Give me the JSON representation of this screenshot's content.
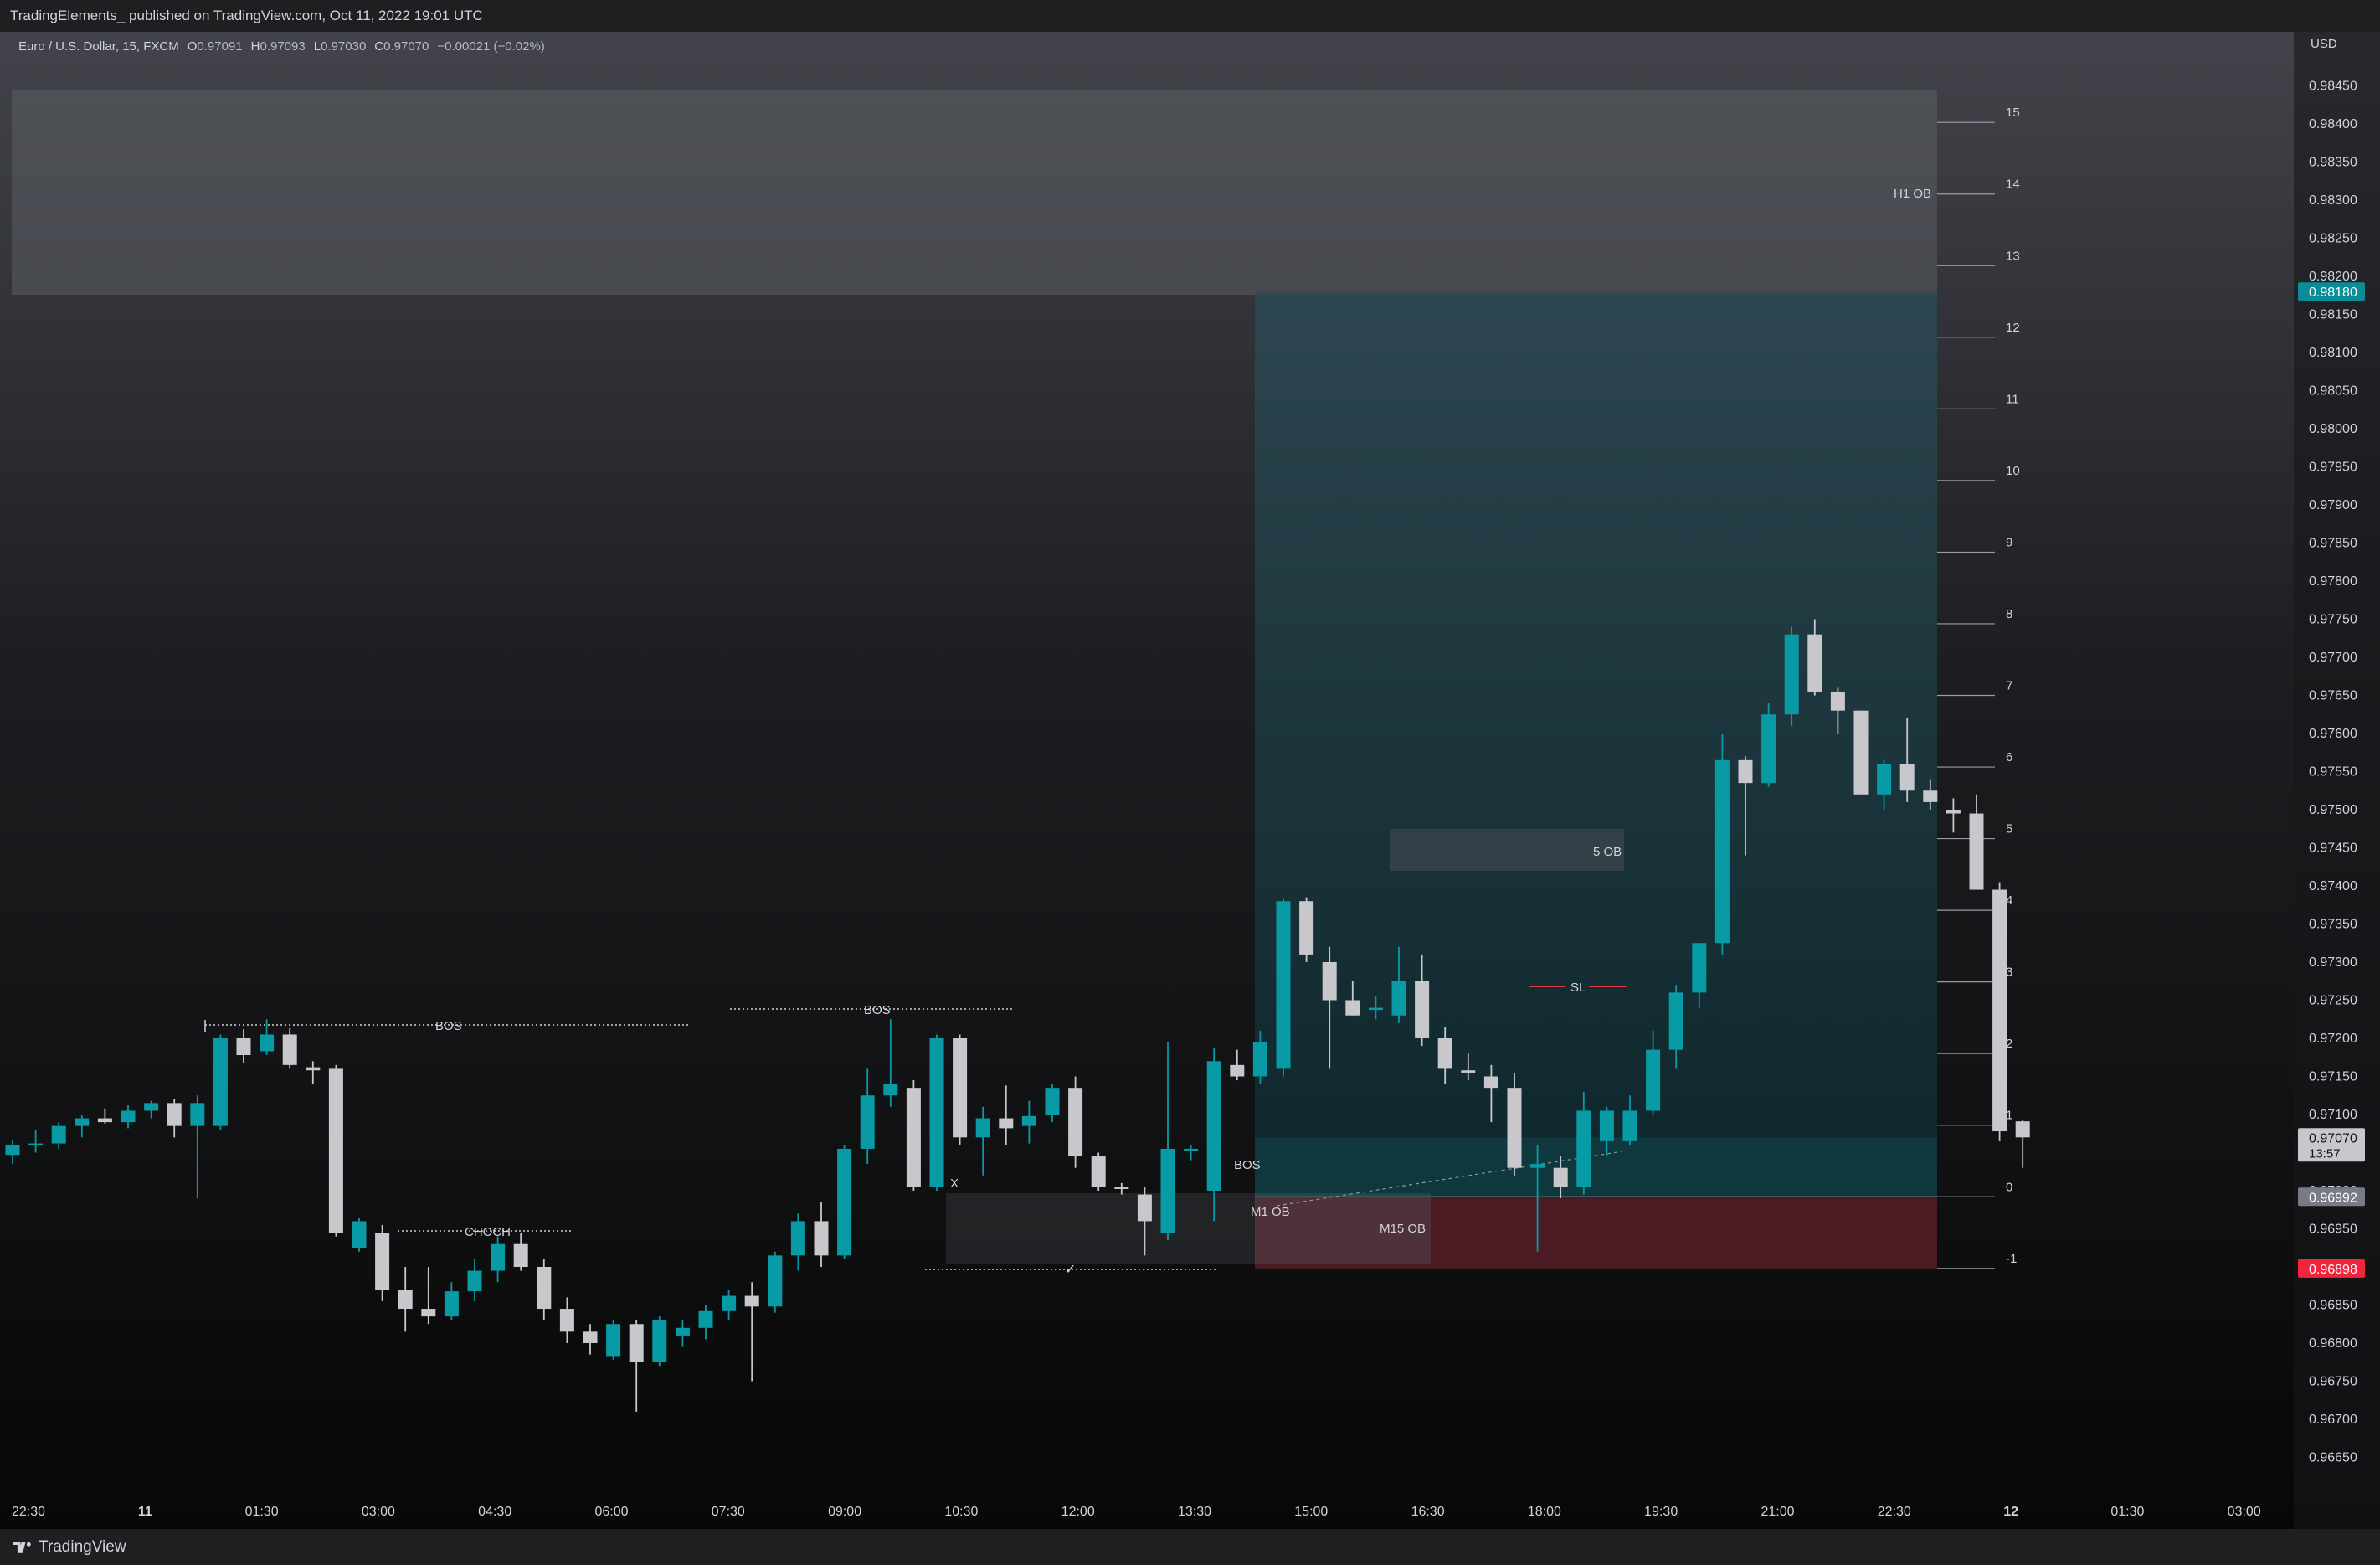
{
  "header": {
    "published_line": "TradingElements_ published on TradingView.com, Oct 11, 2022 19:01 UTC"
  },
  "symbol": {
    "title": "Euro / U.S. Dollar, 15, FXCM",
    "o_label": "O",
    "o_value": "0.97091",
    "h_label": "H",
    "h_value": "0.97093",
    "l_label": "L",
    "l_value": "0.97030",
    "c_label": "C",
    "c_value": "0.97070",
    "change": "−0.00021 (−0.02%)"
  },
  "footer": {
    "brand": "TradingView",
    "brand_icon": "tradingview-logo-icon"
  },
  "colors": {
    "background_top": "#43444b",
    "background_bottom": "#070707",
    "bull": "#089ba6",
    "bear": "#c8c8cc",
    "target_zone": "#154049",
    "stop_zone": "#4a1b22",
    "price_tag_current": "#c8c8cc",
    "price_tag_target": "#0a8d99",
    "price_tag_stop": "#f0253b",
    "price_tag_entry": "#787b86",
    "sl_line": "#e23a43"
  },
  "chart_data": {
    "type": "candlestick",
    "title": "Euro / U.S. Dollar, 15, FXCM",
    "currency_label": "USD",
    "x_start_label": "22:30",
    "x_tick_labels": [
      "22:30",
      "11",
      "01:30",
      "03:00",
      "04:30",
      "06:00",
      "07:30",
      "09:00",
      "10:30",
      "12:00",
      "13:30",
      "15:00",
      "16:30",
      "18:00",
      "19:30",
      "21:00",
      "22:30",
      "12",
      "01:30",
      "03:00"
    ],
    "y_range": [
      0.9663,
      0.9849
    ],
    "y_tick_labels": [
      "0.98450",
      "0.98400",
      "0.98350",
      "0.98300",
      "0.98250",
      "0.98200",
      "0.98150",
      "0.98100",
      "0.98050",
      "0.98000",
      "0.97950",
      "0.97900",
      "0.97850",
      "0.97800",
      "0.97750",
      "0.97700",
      "0.97650",
      "0.97600",
      "0.97550",
      "0.97500",
      "0.97450",
      "0.97400",
      "0.97350",
      "0.97300",
      "0.97250",
      "0.97200",
      "0.97150",
      "0.97100",
      "0.97050",
      "0.97000",
      "0.96950",
      "0.96900",
      "0.96850",
      "0.96800",
      "0.96750",
      "0.96700",
      "0.96650"
    ],
    "price_tags": {
      "current": "0.97070",
      "countdown": "13:57",
      "target": "0.98180",
      "entry": "0.96992",
      "stop": "0.96898"
    },
    "r_levels": {
      "labels": [
        "15",
        "14",
        "13",
        "12",
        "11",
        "10",
        "9",
        "8",
        "7",
        "6",
        "5",
        "4",
        "3",
        "2",
        "1",
        "0",
        "-1"
      ],
      "zero_price": 0.96992,
      "step": 0.00094
    },
    "candles": [
      {
        "o": 0.97047,
        "h": 0.97067,
        "l": 0.97035,
        "c": 0.9706
      },
      {
        "o": 0.9706,
        "h": 0.9708,
        "l": 0.9705,
        "c": 0.97062
      },
      {
        "o": 0.97062,
        "h": 0.9709,
        "l": 0.97055,
        "c": 0.97085
      },
      {
        "o": 0.97085,
        "h": 0.971,
        "l": 0.9707,
        "c": 0.97095
      },
      {
        "o": 0.97095,
        "h": 0.97108,
        "l": 0.97088,
        "c": 0.9709
      },
      {
        "o": 0.9709,
        "h": 0.97112,
        "l": 0.97082,
        "c": 0.97105
      },
      {
        "o": 0.97105,
        "h": 0.97118,
        "l": 0.97095,
        "c": 0.97115
      },
      {
        "o": 0.97115,
        "h": 0.9712,
        "l": 0.9707,
        "c": 0.97085
      },
      {
        "o": 0.97085,
        "h": 0.97125,
        "l": 0.9699,
        "c": 0.97115
      },
      {
        "o": 0.97085,
        "h": 0.97205,
        "l": 0.9708,
        "c": 0.972
      },
      {
        "o": 0.972,
        "h": 0.97212,
        "l": 0.97168,
        "c": 0.97178
      },
      {
        "o": 0.97183,
        "h": 0.97225,
        "l": 0.97178,
        "c": 0.97205
      },
      {
        "o": 0.97205,
        "h": 0.97213,
        "l": 0.9716,
        "c": 0.97165
      },
      {
        "o": 0.97162,
        "h": 0.9717,
        "l": 0.9714,
        "c": 0.97158
      },
      {
        "o": 0.9716,
        "h": 0.97165,
        "l": 0.9694,
        "c": 0.96945
      },
      {
        "o": 0.96925,
        "h": 0.96965,
        "l": 0.9692,
        "c": 0.9696
      },
      {
        "o": 0.96945,
        "h": 0.96955,
        "l": 0.96855,
        "c": 0.9687
      },
      {
        "o": 0.9687,
        "h": 0.969,
        "l": 0.96815,
        "c": 0.96845
      },
      {
        "o": 0.96845,
        "h": 0.969,
        "l": 0.96825,
        "c": 0.96835
      },
      {
        "o": 0.96835,
        "h": 0.9688,
        "l": 0.9683,
        "c": 0.96868
      },
      {
        "o": 0.96868,
        "h": 0.9691,
        "l": 0.96855,
        "c": 0.96895
      },
      {
        "o": 0.96895,
        "h": 0.9694,
        "l": 0.9688,
        "c": 0.9693
      },
      {
        "o": 0.9693,
        "h": 0.96945,
        "l": 0.96895,
        "c": 0.969
      },
      {
        "o": 0.969,
        "h": 0.9691,
        "l": 0.9683,
        "c": 0.96845
      },
      {
        "o": 0.96845,
        "h": 0.9686,
        "l": 0.968,
        "c": 0.96815
      },
      {
        "o": 0.96815,
        "h": 0.96825,
        "l": 0.96785,
        "c": 0.968
      },
      {
        "o": 0.96783,
        "h": 0.9683,
        "l": 0.96778,
        "c": 0.96825
      },
      {
        "o": 0.96825,
        "h": 0.9683,
        "l": 0.9671,
        "c": 0.96775
      },
      {
        "o": 0.96775,
        "h": 0.96835,
        "l": 0.9677,
        "c": 0.9683
      },
      {
        "o": 0.9681,
        "h": 0.9683,
        "l": 0.96795,
        "c": 0.9682
      },
      {
        "o": 0.9682,
        "h": 0.9685,
        "l": 0.96805,
        "c": 0.96842
      },
      {
        "o": 0.96842,
        "h": 0.9687,
        "l": 0.9683,
        "c": 0.96862
      },
      {
        "o": 0.96862,
        "h": 0.9688,
        "l": 0.9675,
        "c": 0.96848
      },
      {
        "o": 0.96848,
        "h": 0.9692,
        "l": 0.9684,
        "c": 0.96915
      },
      {
        "o": 0.96915,
        "h": 0.9697,
        "l": 0.96895,
        "c": 0.9696
      },
      {
        "o": 0.9696,
        "h": 0.96985,
        "l": 0.969,
        "c": 0.96915
      },
      {
        "o": 0.96915,
        "h": 0.9706,
        "l": 0.9691,
        "c": 0.97055
      },
      {
        "o": 0.97055,
        "h": 0.9716,
        "l": 0.97035,
        "c": 0.97125
      },
      {
        "o": 0.97125,
        "h": 0.97225,
        "l": 0.9711,
        "c": 0.9714
      },
      {
        "o": 0.97135,
        "h": 0.97145,
        "l": 0.97,
        "c": 0.97005
      },
      {
        "o": 0.97005,
        "h": 0.97205,
        "l": 0.97,
        "c": 0.972
      },
      {
        "o": 0.972,
        "h": 0.97205,
        "l": 0.9706,
        "c": 0.9707
      },
      {
        "o": 0.9707,
        "h": 0.9711,
        "l": 0.9702,
        "c": 0.97095
      },
      {
        "o": 0.97095,
        "h": 0.97138,
        "l": 0.9706,
        "c": 0.97082
      },
      {
        "o": 0.97085,
        "h": 0.97118,
        "l": 0.97062,
        "c": 0.97098
      },
      {
        "o": 0.971,
        "h": 0.9714,
        "l": 0.9709,
        "c": 0.97135
      },
      {
        "o": 0.97135,
        "h": 0.9715,
        "l": 0.9703,
        "c": 0.97045
      },
      {
        "o": 0.97045,
        "h": 0.9705,
        "l": 0.97,
        "c": 0.97005
      },
      {
        "o": 0.97005,
        "h": 0.9701,
        "l": 0.96995,
        "c": 0.97003
      },
      {
        "o": 0.96995,
        "h": 0.97005,
        "l": 0.96915,
        "c": 0.9696
      },
      {
        "o": 0.96945,
        "h": 0.97195,
        "l": 0.96935,
        "c": 0.97055
      },
      {
        "o": 0.97055,
        "h": 0.9706,
        "l": 0.9704,
        "c": 0.97055
      },
      {
        "o": 0.97,
        "h": 0.97188,
        "l": 0.9696,
        "c": 0.9717
      },
      {
        "o": 0.97165,
        "h": 0.97185,
        "l": 0.97145,
        "c": 0.9715
      },
      {
        "o": 0.9715,
        "h": 0.9721,
        "l": 0.9714,
        "c": 0.97195
      },
      {
        "o": 0.9716,
        "h": 0.97383,
        "l": 0.9715,
        "c": 0.9738
      },
      {
        "o": 0.9738,
        "h": 0.97385,
        "l": 0.973,
        "c": 0.9731
      },
      {
        "o": 0.973,
        "h": 0.9732,
        "l": 0.9716,
        "c": 0.9725
      },
      {
        "o": 0.9725,
        "h": 0.97275,
        "l": 0.9723,
        "c": 0.9723
      },
      {
        "o": 0.9724,
        "h": 0.97255,
        "l": 0.97225,
        "c": 0.9724
      },
      {
        "o": 0.9723,
        "h": 0.9732,
        "l": 0.9722,
        "c": 0.97275
      },
      {
        "o": 0.97275,
        "h": 0.9731,
        "l": 0.9719,
        "c": 0.972
      },
      {
        "o": 0.972,
        "h": 0.97215,
        "l": 0.9714,
        "c": 0.9716
      },
      {
        "o": 0.97158,
        "h": 0.9718,
        "l": 0.97145,
        "c": 0.97155
      },
      {
        "o": 0.9715,
        "h": 0.97165,
        "l": 0.9709,
        "c": 0.97135
      },
      {
        "o": 0.97135,
        "h": 0.97155,
        "l": 0.9702,
        "c": 0.9703
      },
      {
        "o": 0.9703,
        "h": 0.9706,
        "l": 0.9692,
        "c": 0.97035
      },
      {
        "o": 0.9703,
        "h": 0.97045,
        "l": 0.9699,
        "c": 0.97005
      },
      {
        "o": 0.97005,
        "h": 0.9713,
        "l": 0.96995,
        "c": 0.97105
      },
      {
        "o": 0.97065,
        "h": 0.9711,
        "l": 0.97045,
        "c": 0.97105
      },
      {
        "o": 0.97065,
        "h": 0.97125,
        "l": 0.9706,
        "c": 0.97105
      },
      {
        "o": 0.97105,
        "h": 0.9721,
        "l": 0.971,
        "c": 0.97185
      },
      {
        "o": 0.97185,
        "h": 0.9727,
        "l": 0.9716,
        "c": 0.9726
      },
      {
        "o": 0.9726,
        "h": 0.9731,
        "l": 0.9724,
        "c": 0.97325
      },
      {
        "o": 0.97325,
        "h": 0.976,
        "l": 0.9731,
        "c": 0.97565
      },
      {
        "o": 0.97565,
        "h": 0.9757,
        "l": 0.9744,
        "c": 0.97535
      },
      {
        "o": 0.97535,
        "h": 0.9764,
        "l": 0.9753,
        "c": 0.97625
      },
      {
        "o": 0.97625,
        "h": 0.9774,
        "l": 0.9761,
        "c": 0.9773
      },
      {
        "o": 0.9773,
        "h": 0.9775,
        "l": 0.9765,
        "c": 0.97655
      },
      {
        "o": 0.97655,
        "h": 0.9766,
        "l": 0.976,
        "c": 0.9763
      },
      {
        "o": 0.9763,
        "h": 0.9763,
        "l": 0.9752,
        "c": 0.9752
      },
      {
        "o": 0.9752,
        "h": 0.97565,
        "l": 0.975,
        "c": 0.9756
      },
      {
        "o": 0.9756,
        "h": 0.9762,
        "l": 0.9751,
        "c": 0.97525
      },
      {
        "o": 0.97525,
        "h": 0.9754,
        "l": 0.975,
        "c": 0.9751
      },
      {
        "o": 0.975,
        "h": 0.97515,
        "l": 0.9747,
        "c": 0.97495
      },
      {
        "o": 0.97495,
        "h": 0.9752,
        "l": 0.9741,
        "c": 0.97395
      },
      {
        "o": 0.97395,
        "h": 0.97405,
        "l": 0.97065,
        "c": 0.97078
      },
      {
        "o": 0.97091,
        "h": 0.97093,
        "l": 0.9703,
        "c": 0.9707
      }
    ],
    "annotations": [
      {
        "text": "BOS",
        "kind": "structure-break"
      },
      {
        "text": "BOS",
        "kind": "structure-break"
      },
      {
        "text": "CHOCH",
        "kind": "change-of-character"
      },
      {
        "text": "✓",
        "kind": "liquidity-sweep"
      },
      {
        "text": "X",
        "kind": "marker"
      },
      {
        "text": "BOS",
        "kind": "structure-break"
      },
      {
        "text": "M1 OB",
        "kind": "order-block"
      },
      {
        "text": "M15 OB",
        "kind": "order-block"
      },
      {
        "text": "5 OB",
        "kind": "order-block"
      },
      {
        "text": "H1 OB",
        "kind": "order-block"
      },
      {
        "text": "SL",
        "kind": "stop-loss"
      }
    ]
  }
}
